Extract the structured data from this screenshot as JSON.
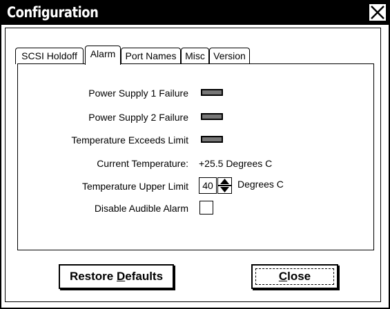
{
  "window": {
    "title": "Configuration"
  },
  "tabs": [
    {
      "label": "SCSI Holdoff"
    },
    {
      "label": "Alarm"
    },
    {
      "label": "Port Names"
    },
    {
      "label": "Misc"
    },
    {
      "label": "Version"
    }
  ],
  "alarm": {
    "ps1_label": "Power Supply 1 Failure",
    "ps2_label": "Power Supply 2 Failure",
    "temp_exceeds_label": "Temperature Exceeds Limit",
    "current_temp_label": "Current Temperature:",
    "current_temp_value": "+25.5 Degrees C",
    "upper_limit_label": "Temperature Upper Limit",
    "upper_limit_value": "40",
    "upper_limit_unit": "Degrees C",
    "disable_alarm_label": "Disable Audible Alarm"
  },
  "buttons": {
    "restore_pre": "Restore ",
    "restore_mnemonic": "D",
    "restore_post": "efaults",
    "close_mnemonic": "C",
    "close_post": "lose"
  }
}
